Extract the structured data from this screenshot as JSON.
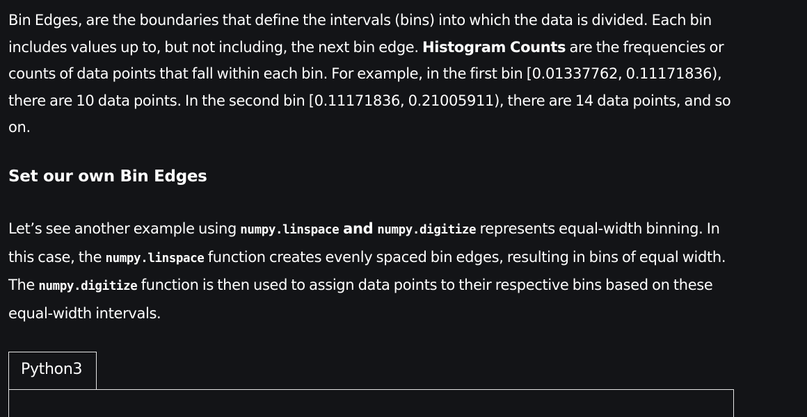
{
  "para1": {
    "t1": "Bin Edges, are the boundaries that define the intervals (bins) into which the data is divided. Each bin includes values up to, but not including, the next bin edge. ",
    "bold": "Histogram Counts",
    "t2": " are the frequencies or counts of data points that fall within each bin. For example, in the first bin [0.01337762, 0.11171836), there are 10 data points. In the second bin [0.11171836, 0.21005911), there are 14 data points, and so on."
  },
  "heading": "Set our own Bin Edges",
  "para2": {
    "t1": "Let’s see another example using ",
    "code1": "numpy.linspace",
    "and": " and ",
    "code2": "numpy.digitize",
    "t2": " represents equal-width binning. In this case, the ",
    "code3": "numpy.linspace",
    "t3": " function creates evenly spaced bin edges, resulting in bins of equal width. The ",
    "code4": "numpy.digitize",
    "t4": " function is then used to assign data points to their respective bins based on these equal-width intervals."
  },
  "code_tabs": [
    "Python3"
  ],
  "colors": {
    "background": "#131417",
    "text": "#ffffff",
    "border": "#e6e6e6"
  }
}
